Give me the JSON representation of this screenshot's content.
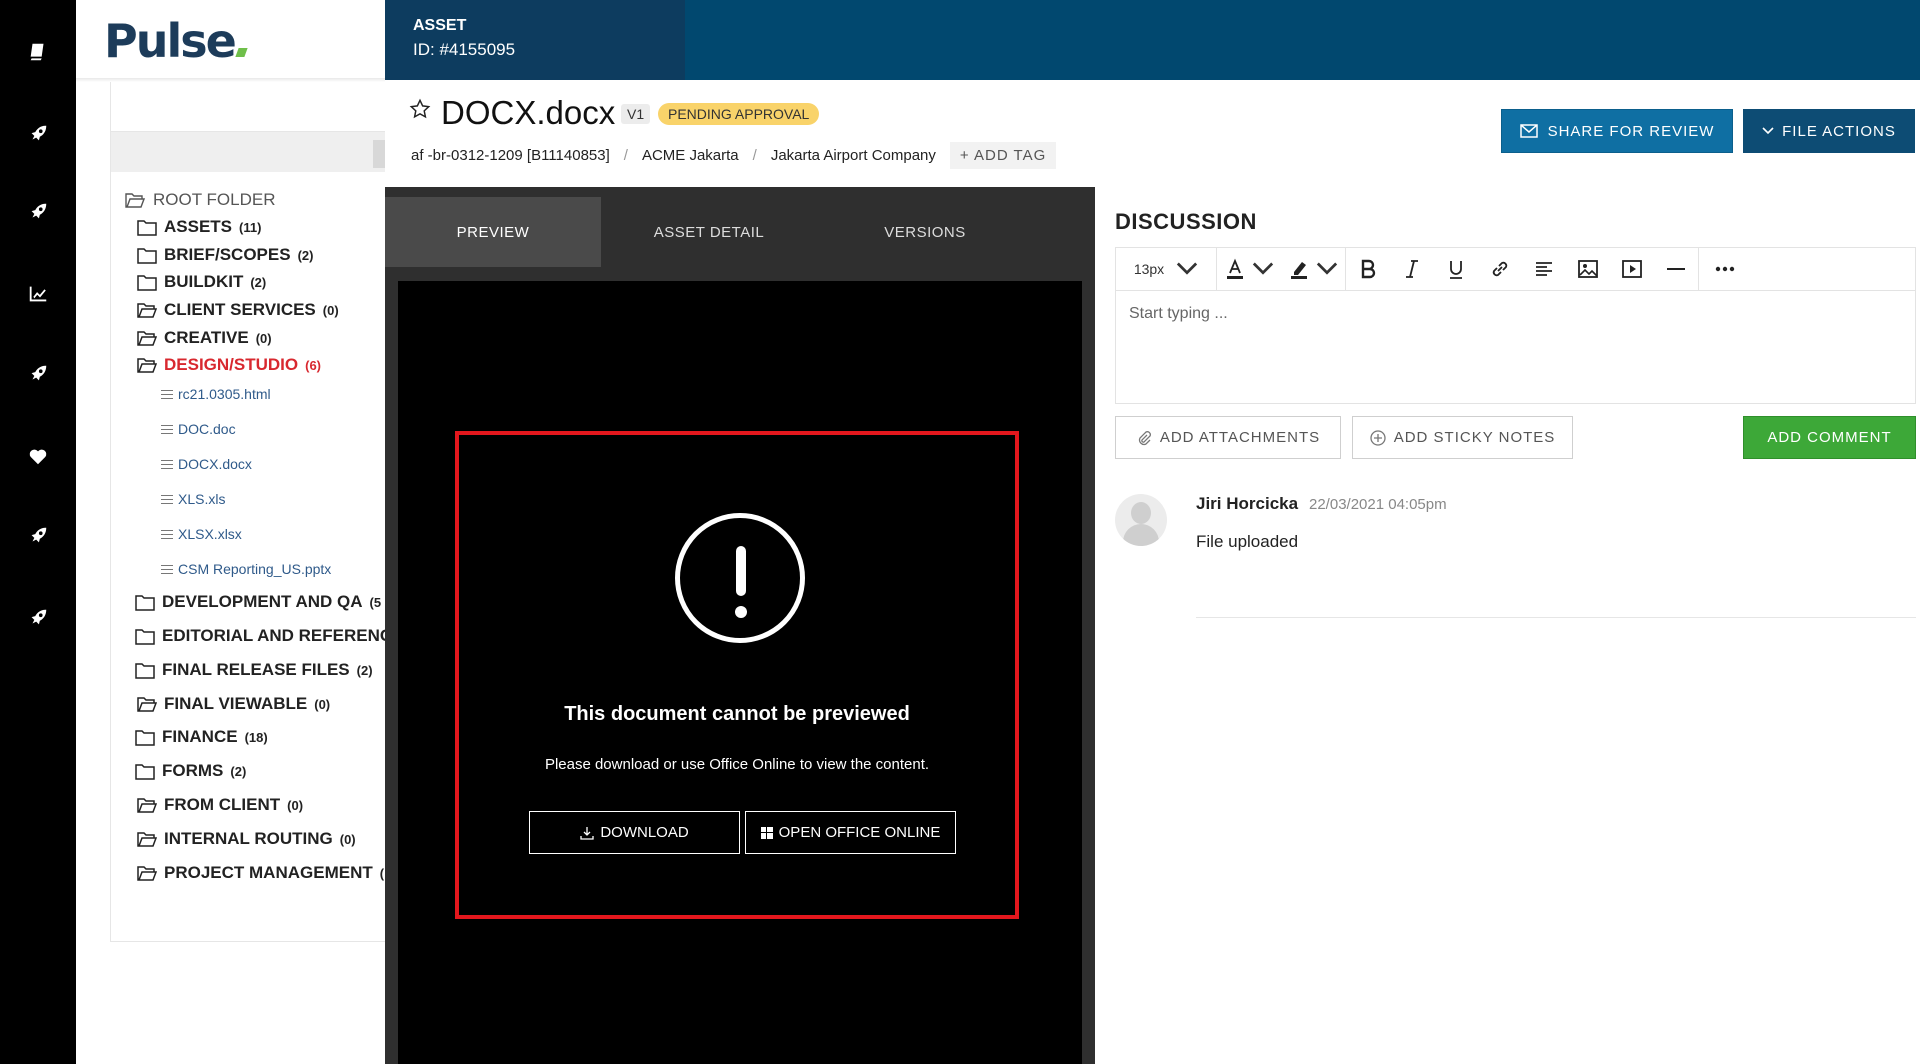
{
  "app": {
    "logo_text": "Pulse"
  },
  "rail": {
    "icons": [
      "book-icon",
      "rocket-icon",
      "rocket-icon",
      "chart-icon",
      "rocket-icon",
      "heart-icon",
      "rocket-icon",
      "rocket-icon"
    ]
  },
  "sidebar": {
    "root_label": "ROOT FOLDER",
    "folders": [
      {
        "name": "ASSETS",
        "count": "(11)"
      },
      {
        "name": "BRIEF/SCOPES",
        "count": "(2)"
      },
      {
        "name": "BUILDKIT",
        "count": "(2)"
      },
      {
        "name": "CLIENT SERVICES",
        "count": "(0)"
      },
      {
        "name": "CREATIVE",
        "count": "(0)"
      },
      {
        "name": "DESIGN/STUDIO",
        "count": "(6)"
      },
      {
        "name": "DEVELOPMENT AND QA",
        "count": "(5"
      },
      {
        "name": "EDITORIAL AND REFERENC",
        "count": ""
      },
      {
        "name": "FINAL RELEASE FILES",
        "count": "(2)"
      },
      {
        "name": "FINAL VIEWABLE",
        "count": "(0)"
      },
      {
        "name": "FINANCE",
        "count": "(18)"
      },
      {
        "name": "FORMS",
        "count": "(2)"
      },
      {
        "name": "FROM CLIENT",
        "count": "(0)"
      },
      {
        "name": "INTERNAL ROUTING",
        "count": "(0)"
      },
      {
        "name": "PROJECT MANAGEMENT",
        "count": "("
      }
    ],
    "files": [
      "rc21.0305.html",
      "DOC.doc",
      "DOCX.docx",
      "XLS.xls",
      "XLSX.xlsx",
      "CSM Reporting_US.pptx"
    ]
  },
  "header": {
    "asset_label": "ASSET",
    "asset_id": "ID: #4155095",
    "title": "DOCX.docx",
    "version": "V1",
    "status": "PENDING APPROVAL",
    "breadcrumb": [
      "af -br-0312-1209 [B11140853]",
      "ACME Jakarta",
      "Jakarta Airport Company"
    ],
    "breadcrumb_sep": "/",
    "add_tag": "+ ADD TAG",
    "share_button": "SHARE FOR REVIEW",
    "file_actions_button": "FILE ACTIONS"
  },
  "preview": {
    "tabs": [
      "PREVIEW",
      "ASSET DETAIL",
      "VERSIONS"
    ],
    "active_tab": "PREVIEW",
    "error_title": "This document cannot be previewed",
    "error_message": "Please download or use Office Online to view the content.",
    "download_button": "DOWNLOAD",
    "office_button": "OPEN OFFICE ONLINE"
  },
  "discussion": {
    "title": "DISCUSSION",
    "font_size": "13px",
    "placeholder": "Start typing ...",
    "attach_button": "ADD ATTACHMENTS",
    "sticky_button": "ADD STICKY NOTES",
    "comment_button": "ADD COMMENT",
    "comments": [
      {
        "author": "Jiri Horcicka",
        "time": "22/03/2021 04:05pm",
        "text": "File uploaded"
      }
    ]
  },
  "colors": {
    "topbar": "#01486f",
    "asset_id_box": "#0d3c5f",
    "share_button": "#0f6fa3",
    "status_badge": "#f9d36a",
    "active_folder": "#d8282f",
    "error_border": "#e3171d",
    "comment_button": "#3da838"
  }
}
